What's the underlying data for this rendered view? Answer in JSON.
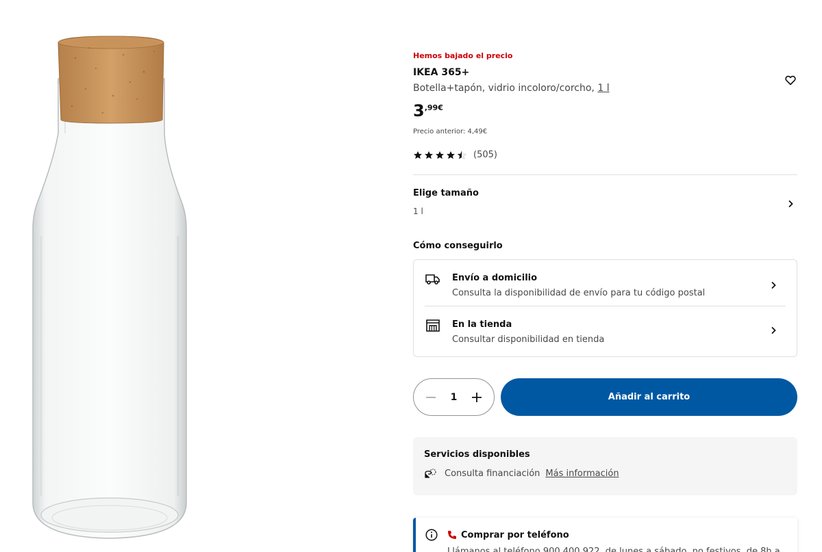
{
  "product": {
    "promo_label": "Hemos bajado el precio",
    "name": "IKEA 365+",
    "description": "Botella+tapón, vidrio incoloro/corcho, ",
    "size_link": "1 l",
    "price_integer": "3",
    "price_decimal": ",99€",
    "old_price": "Precio anterior: 4,49€",
    "rating": 4.5,
    "rating_count": "(505)"
  },
  "size": {
    "title": "Elige tamaño",
    "value": "1 l"
  },
  "delivery": {
    "title": "Cómo conseguirlo",
    "options": [
      {
        "title": "Envío a domicilio",
        "subtitle": "Consulta la disponibilidad de envío para tu código postal",
        "icon": "truck-icon"
      },
      {
        "title": "En la tienda",
        "subtitle": "Consultar disponibilidad en tienda",
        "icon": "store-icon"
      }
    ]
  },
  "cart": {
    "quantity": "1",
    "add_label": "Añadir al carrito"
  },
  "services": {
    "title": "Servicios disponibles",
    "financing": "Consulta financiación",
    "more_link": "Más información"
  },
  "phone": {
    "title": "Comprar por teléfono",
    "body": "Llámanos al teléfono 900 400 922, de lunes a sábado, no festivos, de 8h a"
  },
  "colors": {
    "promo": "#cc0008",
    "primary": "#0058a3",
    "text": "#111111",
    "secondary_text": "#484848",
    "phone_icon": "#cc0008"
  }
}
